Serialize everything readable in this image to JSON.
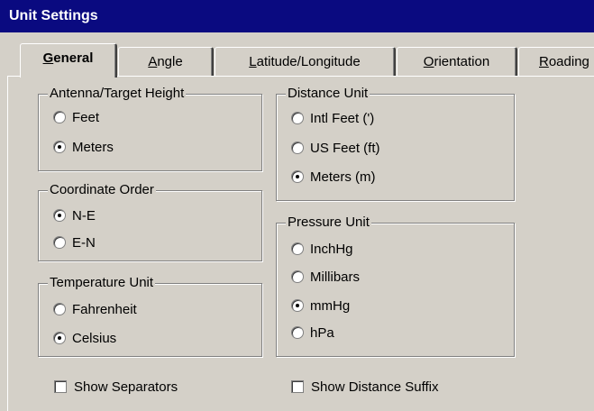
{
  "window": {
    "title": "Unit Settings"
  },
  "tabs": [
    {
      "mnemonic": "G",
      "rest": "eneral"
    },
    {
      "mnemonic": "A",
      "rest": "ngle"
    },
    {
      "mnemonic": "L",
      "rest": "atitude/Longitude"
    },
    {
      "mnemonic": "O",
      "rest": "rientation"
    },
    {
      "mnemonic": "R",
      "rest": "oading"
    }
  ],
  "groups": {
    "antenna": {
      "title": "Antenna/Target Height",
      "options": [
        "Feet",
        "Meters"
      ],
      "selected": "Meters"
    },
    "coord": {
      "title": "Coordinate Order",
      "options": [
        "N-E",
        "E-N"
      ],
      "selected": "N-E"
    },
    "temp": {
      "title": "Temperature Unit",
      "options": [
        "Fahrenheit",
        "Celsius"
      ],
      "selected": "Celsius"
    },
    "distance": {
      "title": "Distance Unit",
      "options": [
        "Intl Feet (')",
        "US Feet (ft)",
        "Meters (m)"
      ],
      "selected": "Meters (m)"
    },
    "pressure": {
      "title": "Pressure Unit",
      "options": [
        "InchHg",
        "Millibars",
        "mmHg",
        "hPa"
      ],
      "selected": "mmHg"
    }
  },
  "checkboxes": {
    "separators": {
      "label": "Show Separators",
      "checked": false
    },
    "suffix": {
      "label": "Show Distance Suffix",
      "checked": false
    }
  }
}
